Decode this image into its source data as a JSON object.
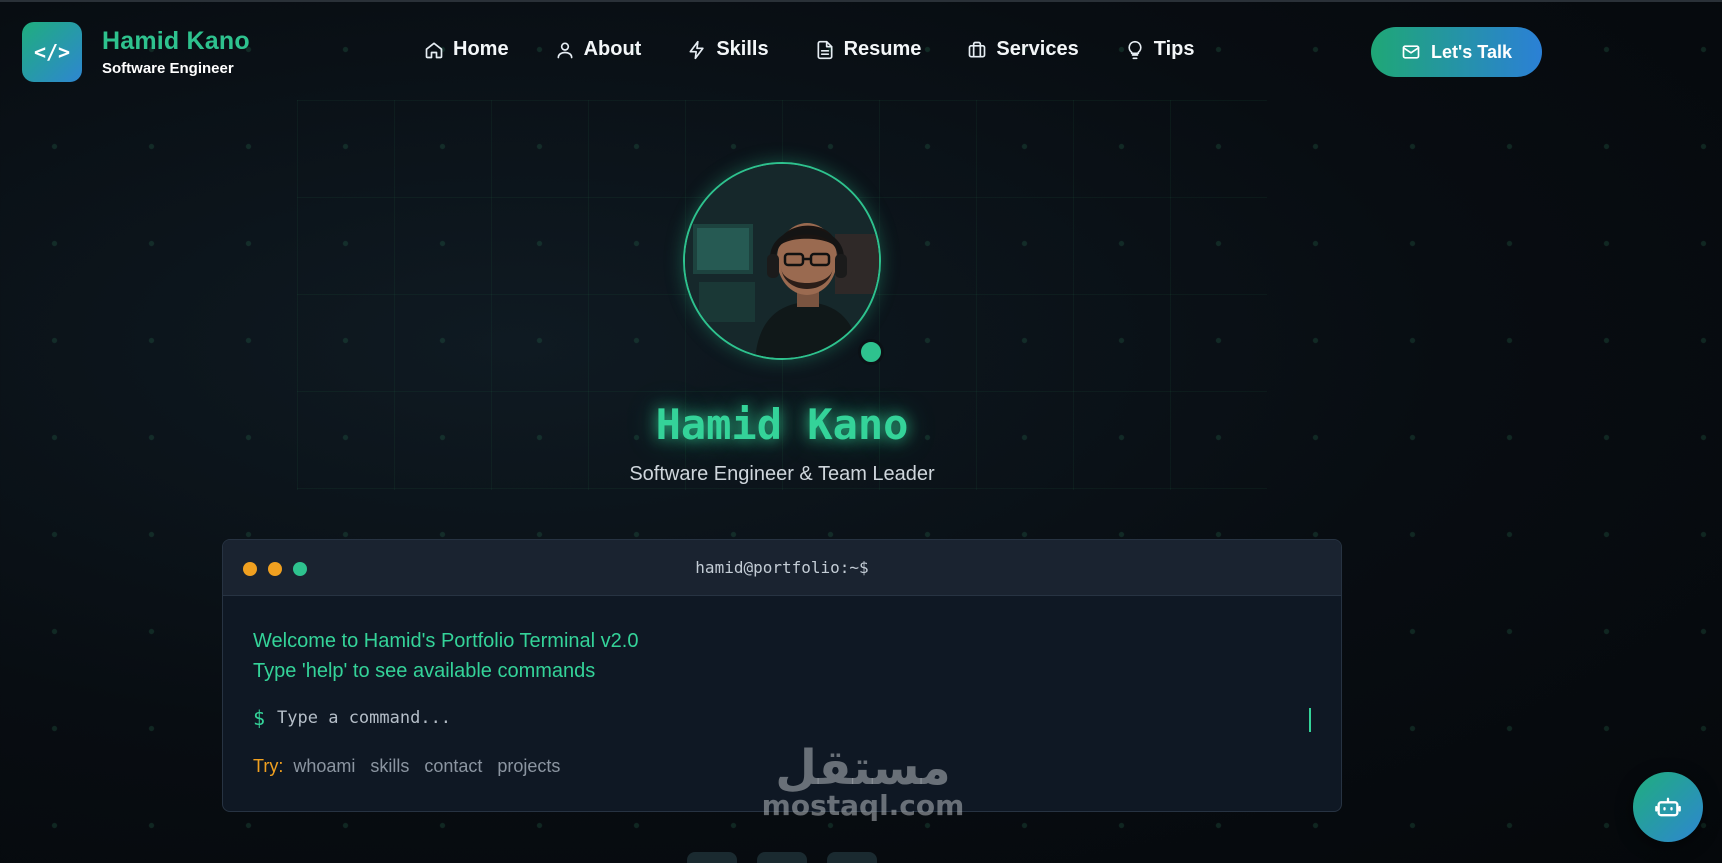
{
  "header": {
    "brand_name": "Hamid Kano",
    "brand_subtitle": "Software Engineer",
    "logo_glyph": "</>",
    "cta_label": "Let's Talk",
    "cta_icon": "mail-icon"
  },
  "nav": {
    "items": [
      {
        "label": "Home",
        "icon": "home-icon"
      },
      {
        "label": "About",
        "icon": "user-icon"
      },
      {
        "label": "Skills",
        "icon": "bolt-icon"
      },
      {
        "label": "Resume",
        "icon": "document-icon"
      },
      {
        "label": "Services",
        "icon": "briefcase-icon"
      },
      {
        "label": "Tips",
        "icon": "lightbulb-icon"
      }
    ]
  },
  "hero": {
    "name": "Hamid Kano",
    "title": "Software Engineer & Team Leader",
    "status": "online"
  },
  "terminal": {
    "title": "hamid@portfolio:~$",
    "welcome_line1": "Welcome to Hamid's Portfolio Terminal v2.0",
    "welcome_line2": "Type 'help' to see available commands",
    "prompt_symbol": "$",
    "input_placeholder": "Type a command...",
    "input_value": "",
    "try_label": "Try:",
    "suggestions": [
      "whoami",
      "skills",
      "contact",
      "projects"
    ]
  },
  "watermark": {
    "arabic": "مستقل",
    "latin": "mostaql.com"
  },
  "chat_button": {
    "icon": "robot-icon"
  },
  "colors": {
    "accent_green": "#34d399",
    "accent_blue": "#2b80d6",
    "warning_orange": "#f0a020",
    "background": "#080d12"
  }
}
